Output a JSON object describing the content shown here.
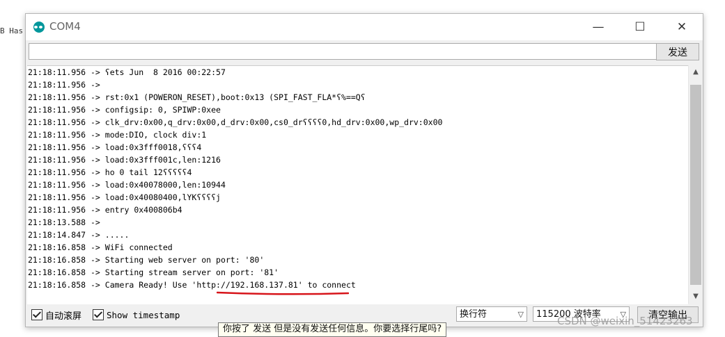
{
  "background": {
    "left_text": "B Has"
  },
  "window": {
    "title": "COM4",
    "controls": {
      "minimize": "—",
      "maximize": "☐",
      "close": "✕"
    }
  },
  "send_row": {
    "input_value": "",
    "send_label": "发送"
  },
  "console": {
    "lines": [
      "21:18:11.956 -> ʕets Jun  8 2016 00:22:57",
      "21:18:11.956 -> ",
      "21:18:11.956 -> rst:0x1 (POWERON_RESET),boot:0x13 (SPI_FAST_FLA*ʕ%==Qʕ",
      "21:18:11.956 -> configsip: 0, SPIWP:0xee",
      "21:18:11.956 -> clk_drv:0x00,q_drv:0x00,d_drv:0x00,cs0_drʕʕʕʕ0,hd_drv:0x00,wp_drv:0x00",
      "21:18:11.956 -> mode:DIO, clock div:1",
      "21:18:11.956 -> load:0x3fff0018,ʕʕʕ4",
      "21:18:11.956 -> load:0x3fff001c,len:1216",
      "21:18:11.956 -> ho 0 tail 12ʕʕʕʕʕ4",
      "21:18:11.956 -> load:0x40078000,len:10944",
      "21:18:11.956 -> load:0x40080400,lYKʕʕʕʕj",
      "21:18:11.956 -> entry 0x400806b4",
      "21:18:13.588 -> ",
      "21:18:14.847 -> .....",
      "21:18:16.858 -> WiFi connected",
      "21:18:16.858 -> Starting web server on port: '80'",
      "21:18:16.858 -> Starting stream server on port: '81'",
      "21:18:16.858 -> Camera Ready! Use 'http://192.168.137.81' to connect"
    ],
    "underline_color": "#d7141a"
  },
  "bottom_bar": {
    "autoscroll_label": "自动滚屏",
    "autoscroll_checked": true,
    "timestamp_label": "Show timestamp",
    "timestamp_checked": true,
    "line_ending": "换行符",
    "baud_rate": "115200 波特率",
    "clear_label": "清空输出"
  },
  "tooltip": "你按了 发送 但是没有发送任何信息。你要选择行尾吗?",
  "watermark": "CSDN @weixin_51423263",
  "colors": {
    "arduino_teal": "#00979c"
  }
}
